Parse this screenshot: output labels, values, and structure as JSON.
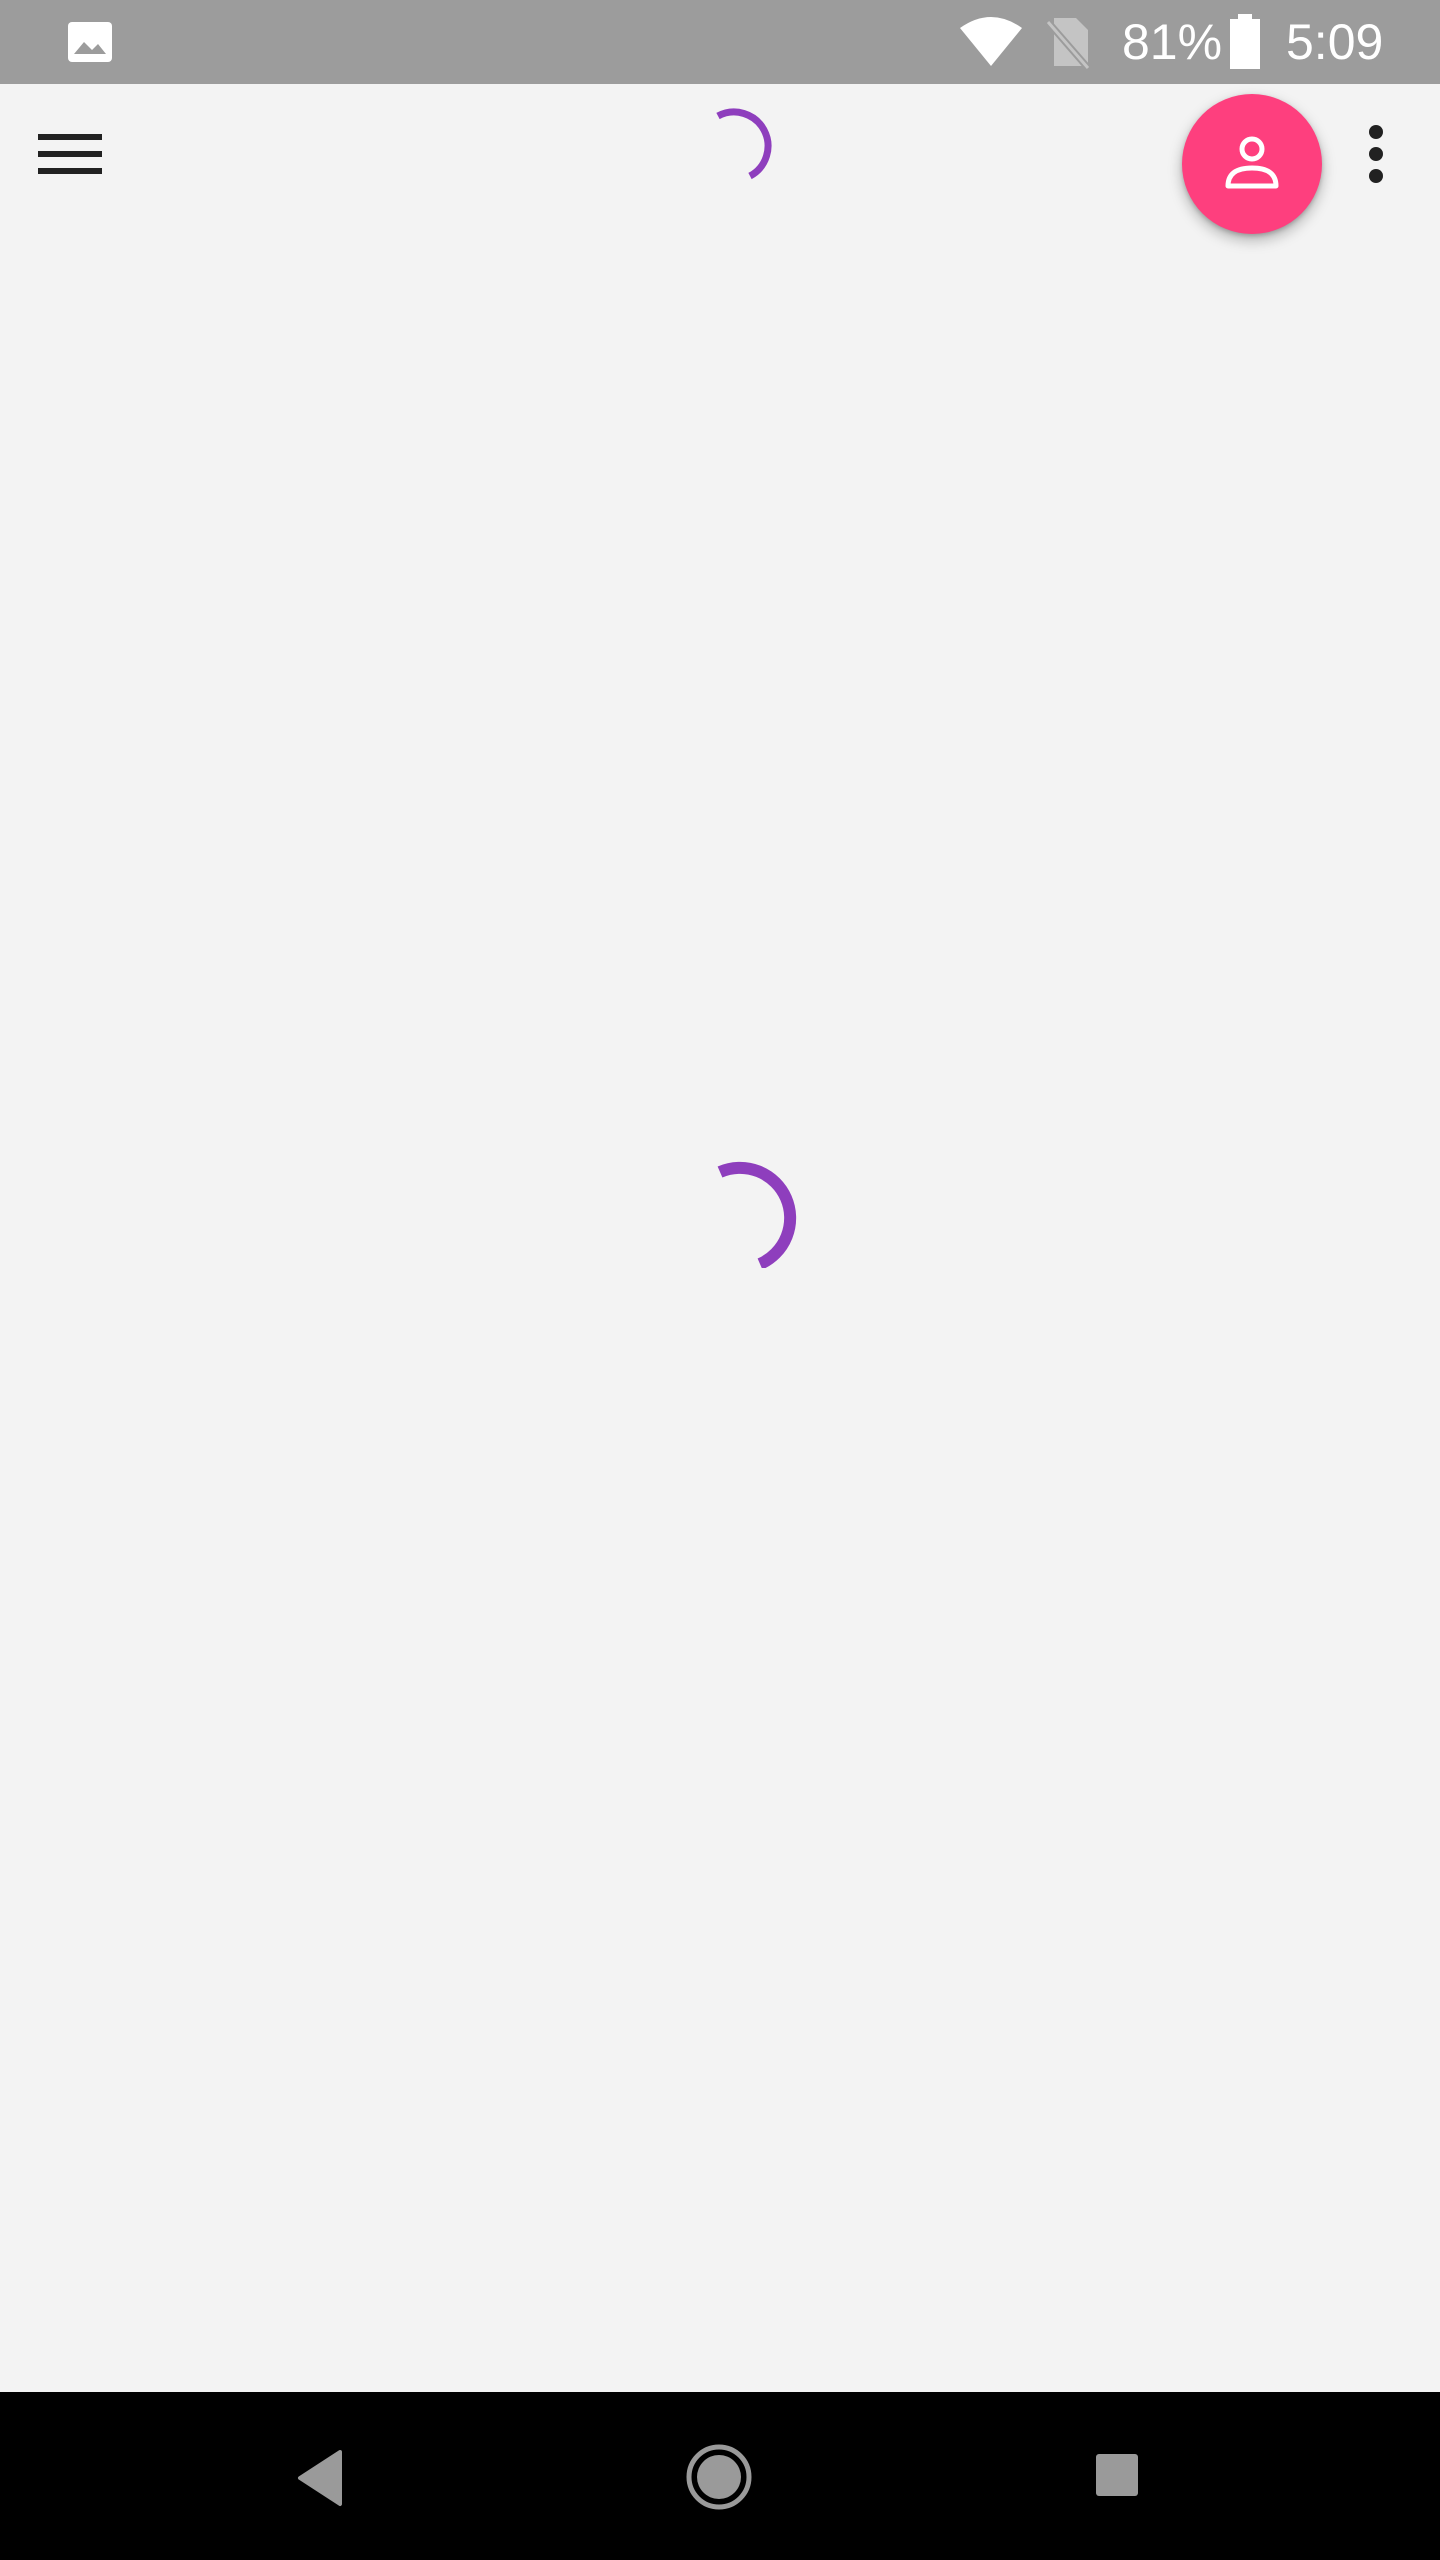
{
  "status_bar": {
    "battery_percent": "81%",
    "time": "5:09",
    "left_icon": "gallery-image-icon",
    "icons": [
      "wifi-icon",
      "no-sim-icon",
      "battery-icon"
    ]
  },
  "app_bar": {
    "menu_icon": "hamburger-menu-icon",
    "loading_icon": "loading-spinner-icon",
    "account_icon": "account-person-icon",
    "overflow_icon": "more-vert-icon"
  },
  "content": {
    "loading_icon": "loading-spinner-icon"
  },
  "nav_bar": {
    "buttons": [
      "back-icon",
      "home-icon",
      "recents-icon"
    ]
  },
  "colors": {
    "status_bar_bg": "#9c9c9c",
    "page_bg": "#f3f3f3",
    "accent_fab": "#fe3f7e",
    "spinner": "#8e3ebd",
    "nav_bar_bg": "#000000"
  }
}
